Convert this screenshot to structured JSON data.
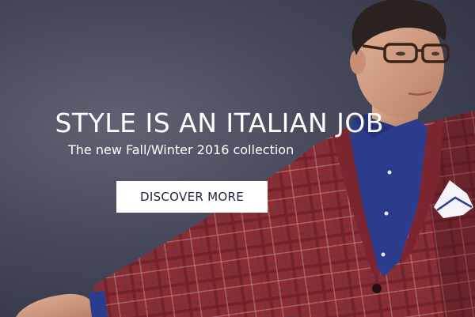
{
  "hero": {
    "headline": "STYLE IS AN ITALIAN JOB",
    "subheadline": "The new Fall/Winter 2016 collection",
    "cta_label": "DISCOVER MORE"
  },
  "colors": {
    "background": "#45485a",
    "jacket": "#8a2d35",
    "shirt": "#2c3c8c",
    "cta_text": "#1e2340"
  }
}
